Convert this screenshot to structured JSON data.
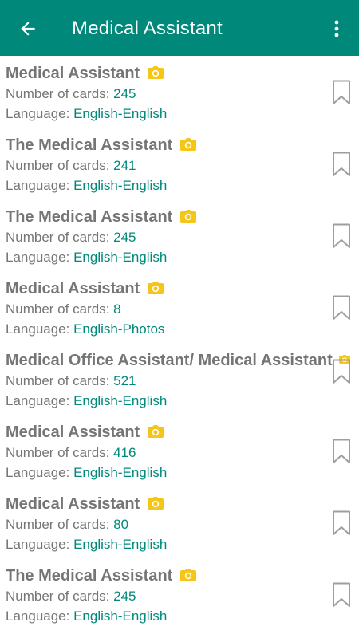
{
  "appbar": {
    "title": "Medical Assistant",
    "back_icon": "arrow-back-icon",
    "more_icon": "more-vert-icon"
  },
  "labels": {
    "cards": "Number of cards: ",
    "language": "Language: "
  },
  "colors": {
    "primary": "#00897b",
    "text_gray": "#757575",
    "camera_yellow": "#f5c518",
    "bookmark_gray": "#9e9e9e"
  },
  "decks": [
    {
      "title": "Medical Assistant",
      "cards": "245",
      "language": "English-English"
    },
    {
      "title": "The Medical Assistant",
      "cards": "241",
      "language": "English-English"
    },
    {
      "title": "The Medical Assistant",
      "cards": "245",
      "language": "English-English"
    },
    {
      "title": "Medical Assistant",
      "cards": "8",
      "language": "English-Photos"
    },
    {
      "title": "Medical Office Assistant/ Medical Assistant",
      "cards": "521",
      "language": "English-English"
    },
    {
      "title": "Medical Assistant",
      "cards": "416",
      "language": "English-English"
    },
    {
      "title": "Medical Assistant",
      "cards": "80",
      "language": "English-English"
    },
    {
      "title": "The Medical Assistant",
      "cards": "245",
      "language": "English-English"
    }
  ]
}
